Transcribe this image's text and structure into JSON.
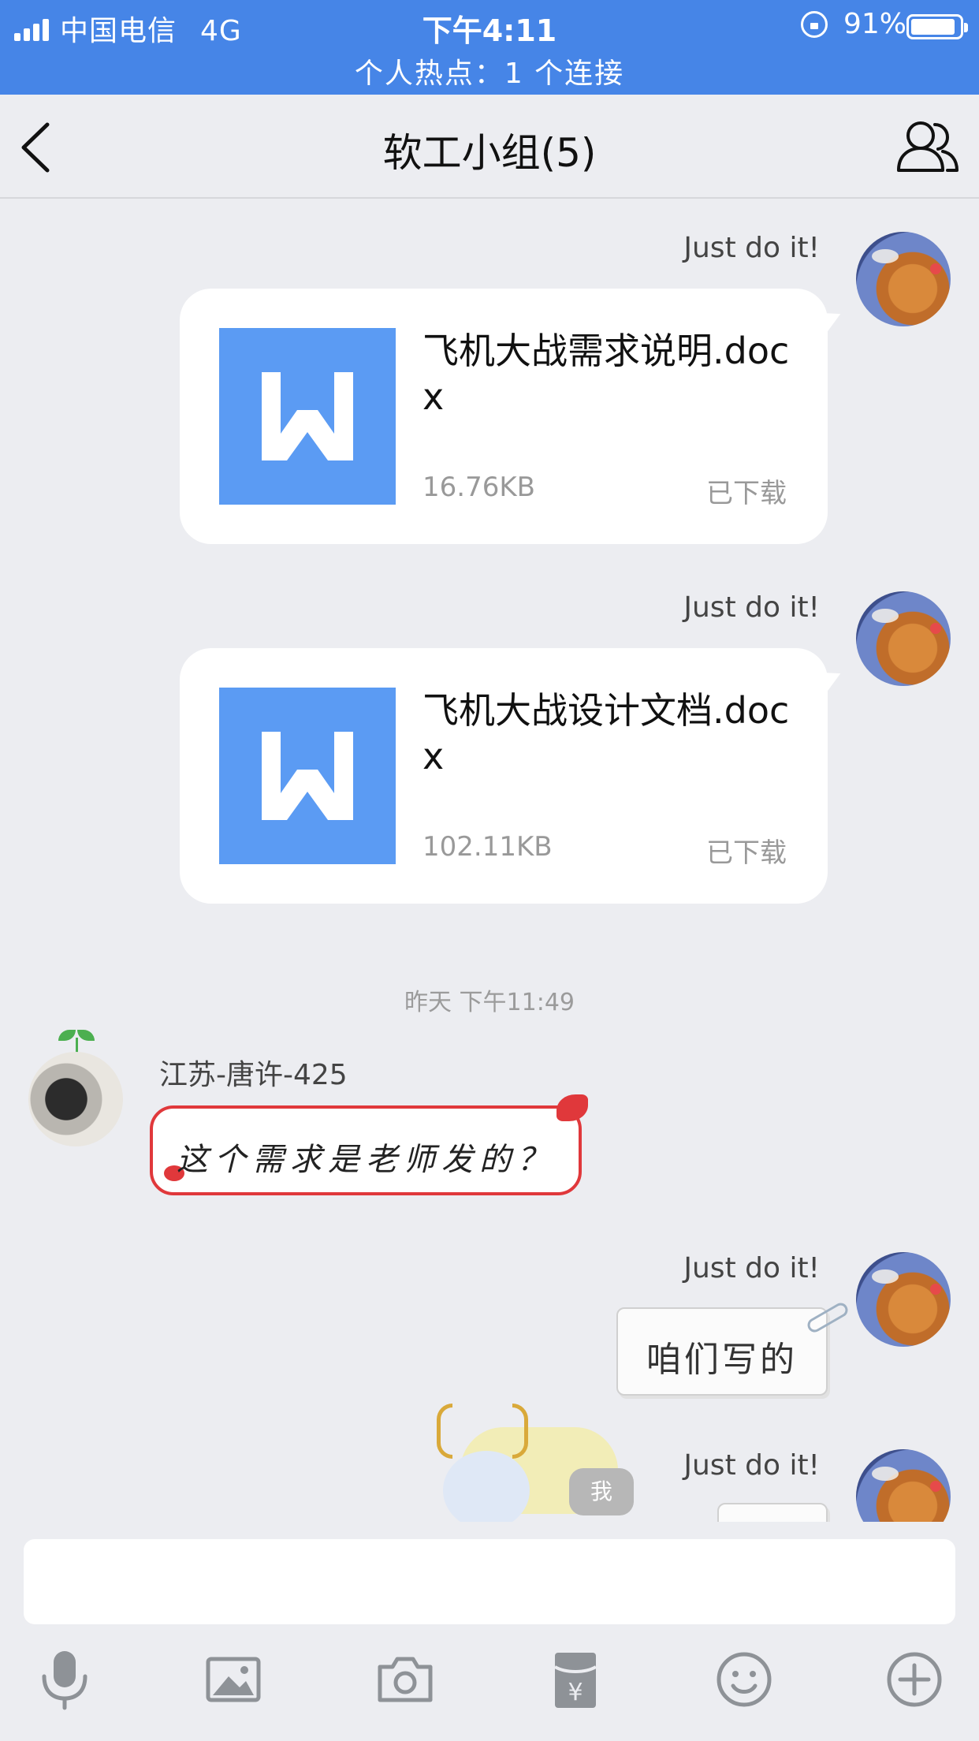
{
  "status_bar": {
    "carrier": "中国电信",
    "network": "4G",
    "time": "下午4:11",
    "battery": "91%",
    "battery_level": 0.91,
    "hotspot": "个人热点：1 个连接"
  },
  "nav": {
    "title": "软工小组(5)",
    "back_icon": "chevron-left-icon",
    "members_icon": "group-members-icon"
  },
  "messages": [
    {
      "type": "file",
      "side": "right",
      "sender": "Just do it!",
      "file_name": "飞机大战需求说明.docx",
      "file_size": "16.76KB",
      "file_status": "已下载",
      "file_icon": "word-doc-icon"
    },
    {
      "type": "file",
      "side": "right",
      "sender": "Just do it!",
      "file_name": "飞机大战设计文档.docx",
      "file_size": "102.11KB",
      "file_status": "已下载",
      "file_icon": "word-doc-icon"
    },
    {
      "type": "timestamp",
      "text": "昨天 下午11:49"
    },
    {
      "type": "text",
      "side": "left",
      "sender": "江苏-唐许-425",
      "text": "这个需求是老师发的？"
    },
    {
      "type": "text",
      "side": "right",
      "sender": "Just do it!",
      "text": "咱们写的"
    },
    {
      "type": "sticker",
      "side": "right",
      "sender": "Just do it!",
      "sticker_tag": "我"
    }
  ],
  "toolbar": {
    "icons": [
      "microphone-icon",
      "image-icon",
      "camera-icon",
      "red-packet-icon",
      "emoji-icon",
      "plus-icon"
    ]
  },
  "colors": {
    "status_bar": "#4685e7",
    "background": "#ecedf1",
    "word_icon": "#5b9bf3",
    "fancy_bubble_border": "#e0383b"
  }
}
